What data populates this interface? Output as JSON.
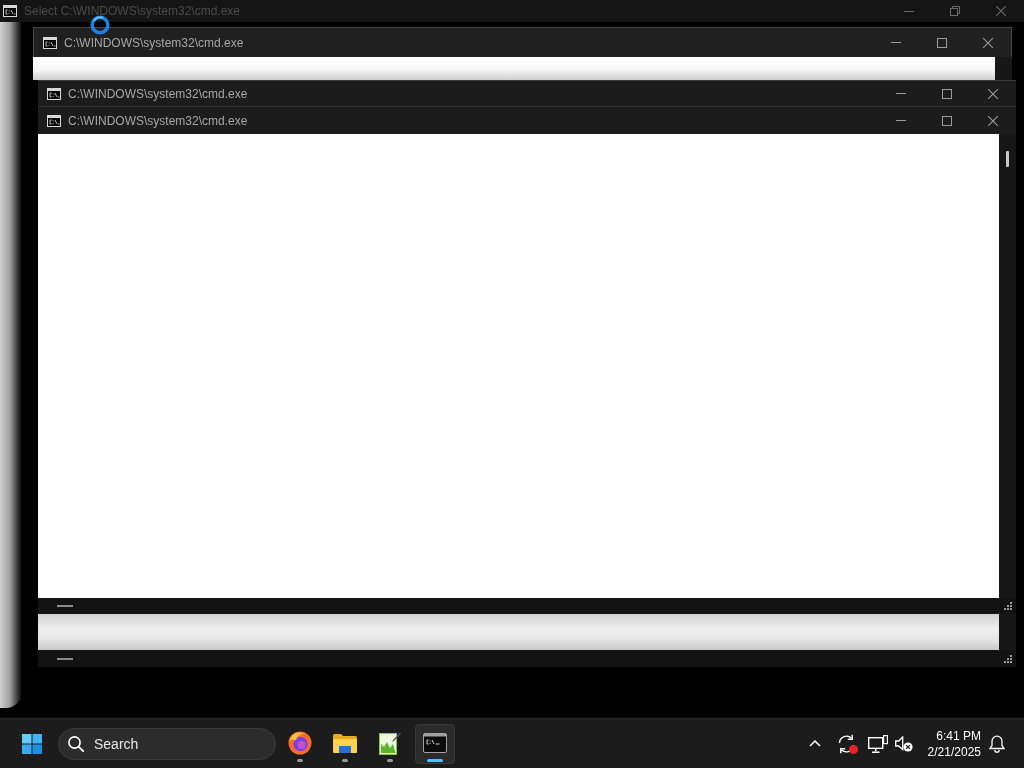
{
  "desktop": {
    "windows": [
      {
        "title": "Select C:\\WINDOWS\\system32\\cmd.exe",
        "maximized": true
      },
      {
        "title": "C:\\WINDOWS\\system32\\cmd.exe",
        "maximized": false
      },
      {
        "title": "C:\\WINDOWS\\system32\\cmd.exe",
        "maximized": false
      },
      {
        "title": "C:\\WINDOWS\\system32\\cmd.exe",
        "maximized": false
      }
    ]
  },
  "taskbar": {
    "search": {
      "placeholder": "Search"
    },
    "apps": [
      {
        "kind": "browser",
        "selected": false
      },
      {
        "kind": "folder",
        "selected": false
      },
      {
        "kind": "editor",
        "selected": false
      },
      {
        "kind": "terminal",
        "selected": true
      }
    ],
    "tray": {
      "time": "6:41 PM",
      "date": "2/21/2025"
    }
  }
}
